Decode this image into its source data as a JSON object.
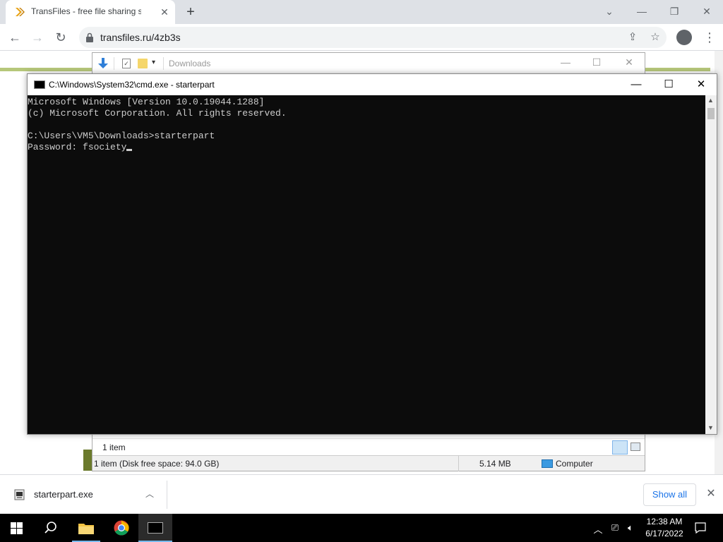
{
  "browser": {
    "tab_title": "TransFiles - free file sharing servi",
    "tab_close": "✕",
    "new_tab": "+",
    "url": "transfiles.ru/4zb3s",
    "back": "←",
    "forward": "→",
    "reload": "↻",
    "minimize": "—",
    "restore": "❐",
    "close": "✕",
    "dropdown": "⌄"
  },
  "explorer": {
    "title": "Downloads",
    "status_items": "1 item",
    "status_disk": "1 item (Disk free space: 94.0 GB)",
    "status_size": "5.14 MB",
    "status_location": "Computer"
  },
  "cmd": {
    "title": "C:\\Windows\\System32\\cmd.exe - starterpart",
    "lines": [
      "Microsoft Windows [Version 10.0.19044.1288]",
      "(c) Microsoft Corporation. All rights reserved.",
      "",
      "C:\\Users\\VM5\\Downloads>starterpart",
      "Password: fsociety"
    ]
  },
  "downloads": {
    "file_name": "starterpart.exe",
    "show_all": "Show all",
    "close": "✕"
  },
  "taskbar": {
    "time": "12:38 AM",
    "date": "6/17/2022"
  },
  "colors": {
    "console_bg": "#0c0c0c",
    "console_fg": "#cccccc",
    "accent_blue": "#1a73e8",
    "taskbar_bg": "#000000"
  }
}
